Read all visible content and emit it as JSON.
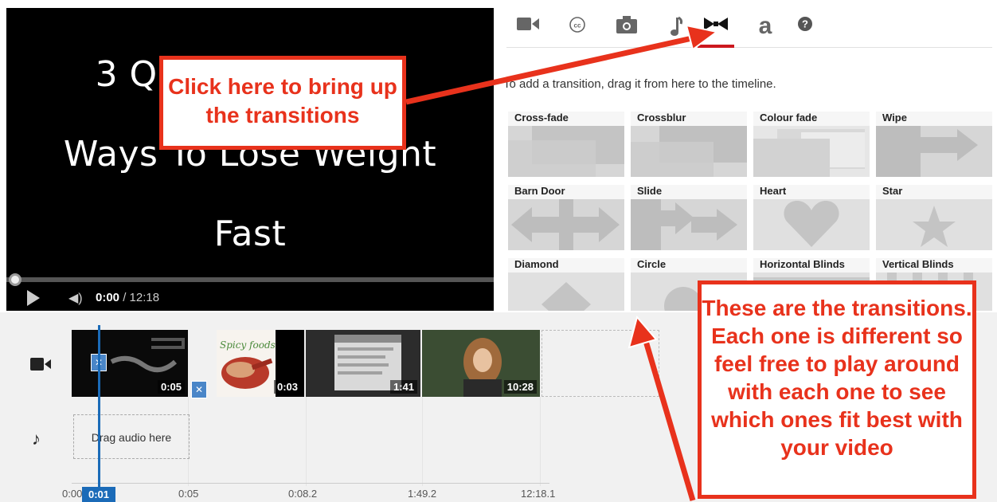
{
  "player": {
    "title_lines": [
      "3 Quick and Easy",
      "Ways To Lose Weight",
      "Fast"
    ],
    "time_current": "0:00",
    "time_total": "/ 12:18"
  },
  "tool_tabs": [
    {
      "icon": "video-camera-icon",
      "active": false
    },
    {
      "icon": "closed-captions-icon",
      "active": false
    },
    {
      "icon": "photo-camera-icon",
      "active": false
    },
    {
      "icon": "music-note-icon",
      "active": false
    },
    {
      "icon": "bowtie-transitions-icon",
      "active": true
    },
    {
      "icon": "text-a-icon",
      "active": false
    },
    {
      "icon": "help-icon",
      "active": false
    }
  ],
  "instructions": "To add a transition, drag it from here to the timeline.",
  "transitions": [
    {
      "label": "Cross-fade",
      "preview": "crossfade"
    },
    {
      "label": "Crossblur",
      "preview": "crossblur"
    },
    {
      "label": "Colour fade",
      "preview": "colourfade"
    },
    {
      "label": "Wipe",
      "preview": "wipe"
    },
    {
      "label": "Barn Door",
      "preview": "barndoor"
    },
    {
      "label": "Slide",
      "preview": "slide"
    },
    {
      "label": "Heart",
      "preview": "heart"
    },
    {
      "label": "Star",
      "preview": "star"
    },
    {
      "label": "Diamond",
      "preview": "diamond"
    },
    {
      "label": "Circle",
      "preview": "circle"
    },
    {
      "label": "Horizontal Blinds",
      "preview": "hblinds"
    },
    {
      "label": "Vertical Blinds",
      "preview": "vblinds"
    }
  ],
  "timeline": {
    "clips": [
      {
        "duration": "0:05"
      },
      {
        "duration": "0:03",
        "caption": "Spicy foods"
      },
      {
        "duration": "1:41"
      },
      {
        "duration": "10:28"
      }
    ],
    "audio_placeholder": "Drag audio here",
    "ruler_labels": [
      "0:00",
      "0:05",
      "0:08.2",
      "1:49.2",
      "12:18.1"
    ],
    "playhead": "0:01"
  },
  "annotations": {
    "callout_1": "Click here to bring up the transitions",
    "callout_2": "These are the transitions. Each one is different so feel free to play around with each one to see which ones fit best with your video"
  },
  "colors": {
    "annotation_red": "#e8321c",
    "active_tab": "#cc181e",
    "playhead_blue": "#1b6bb8"
  }
}
